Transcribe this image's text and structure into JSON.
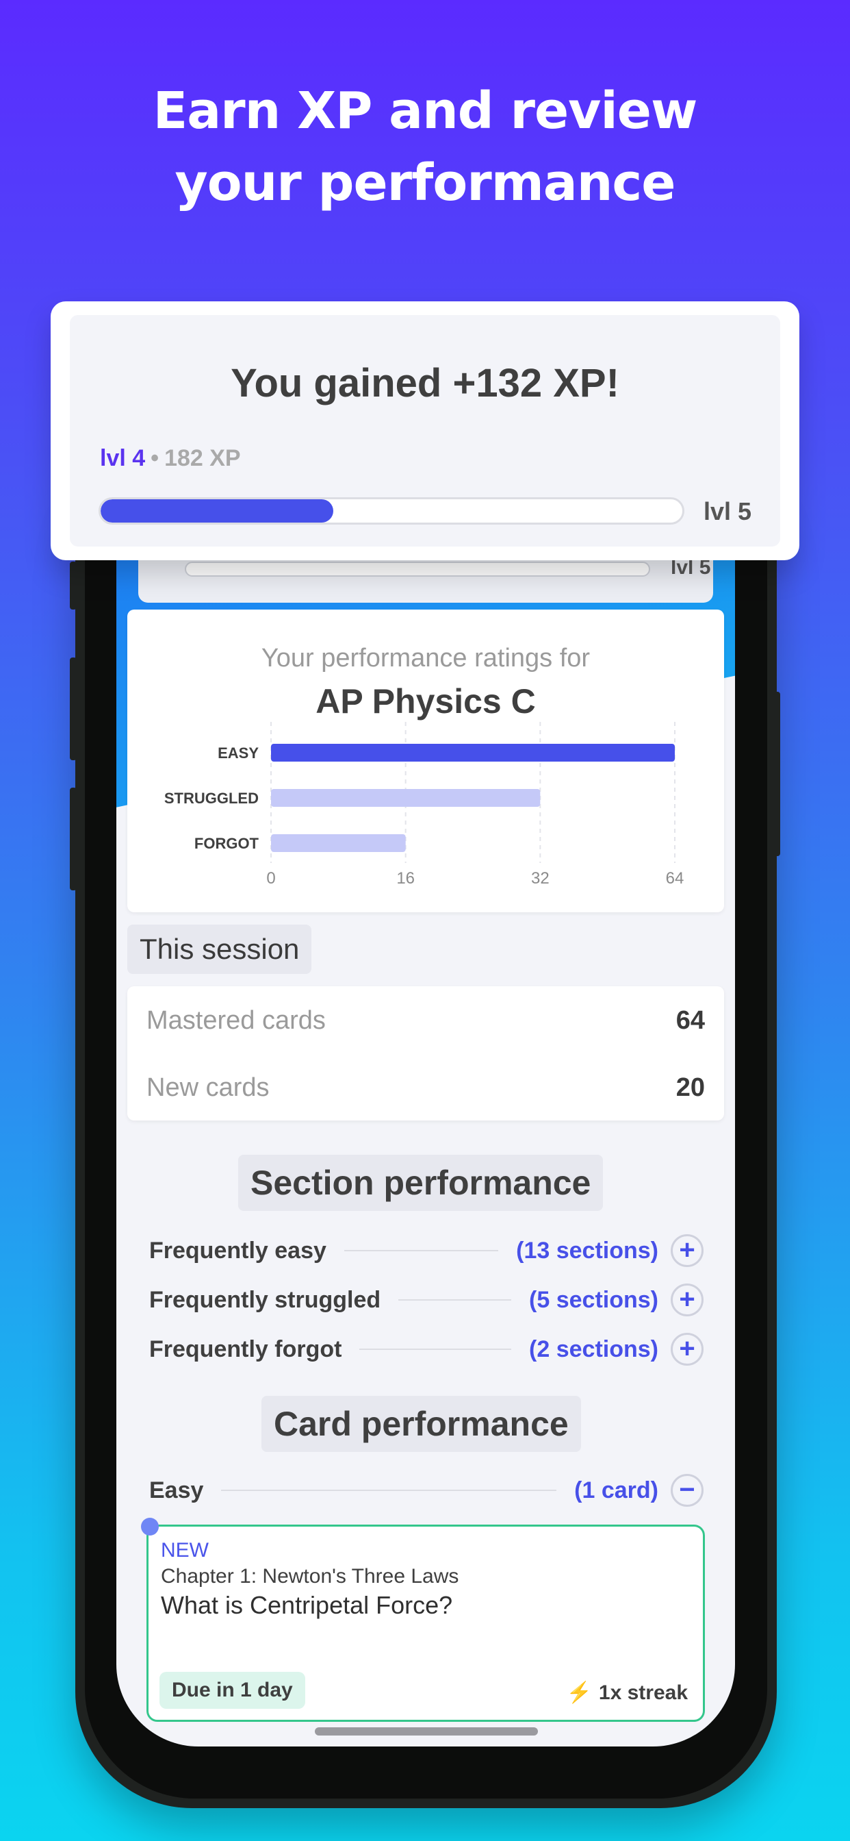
{
  "headline": {
    "line1": "Earn XP and review",
    "line2": "your performance"
  },
  "xp_popup": {
    "title": "You gained +132 XP!",
    "current_level": "lvl 4",
    "separator": "•",
    "xp": "182 XP",
    "next_level": "lvl 5",
    "progress_fraction": 0.4
  },
  "behind_bar": {
    "next_level": "lvl 5"
  },
  "performance_chart": {
    "subtitle": "Your performance ratings for",
    "course": "AP Physics C"
  },
  "chart_data": {
    "type": "bar",
    "orientation": "horizontal",
    "categories": [
      "EASY",
      "STRUGGLED",
      "FORGOT"
    ],
    "values": [
      64,
      32,
      16
    ],
    "xticks": [
      "0",
      "16",
      "32",
      "64"
    ],
    "colors": [
      "#4650ea",
      "#c5c9f8",
      "#c5c9f8"
    ],
    "grid": true
  },
  "session": {
    "label": "This session",
    "rows": [
      {
        "label": "Mastered cards",
        "value": "64"
      },
      {
        "label": "New cards",
        "value": "20"
      }
    ]
  },
  "section_performance": {
    "heading": "Section performance",
    "rows": [
      {
        "name": "Frequently easy",
        "count": "(13 sections)",
        "action": "+"
      },
      {
        "name": "Frequently struggled",
        "count": "(5 sections)",
        "action": "+"
      },
      {
        "name": "Frequently forgot",
        "count": "(2 sections)",
        "action": "+"
      }
    ]
  },
  "card_performance": {
    "heading": "Card performance",
    "row": {
      "name": "Easy",
      "count": "(1 card)",
      "action": "−"
    },
    "card": {
      "tag": "NEW",
      "chapter": "Chapter 1: Newton's Three Laws",
      "question": "What is Centripetal Force?",
      "due": "Due in 1 day",
      "streak_icon": "⚡",
      "streak": "1x streak"
    }
  }
}
